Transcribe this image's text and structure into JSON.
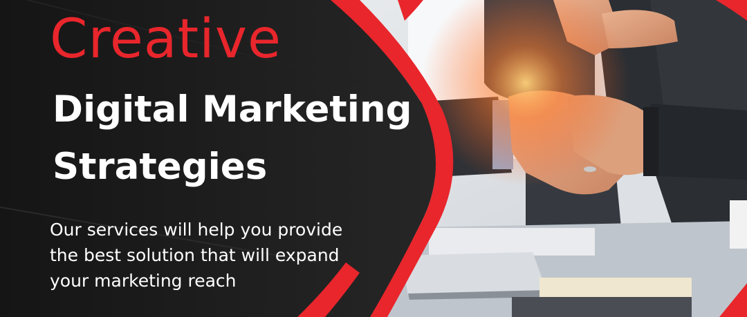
{
  "banner": {
    "headline_accent": "Creative",
    "headline_line1": "Digital Marketing",
    "headline_line2": "Strategies",
    "tagline": [
      "Our services will help you provide",
      "the best solution that will expand",
      "your marketing reach"
    ]
  },
  "colors": {
    "accent_red": "#e8262c",
    "dark_panel": "#1c1c1c",
    "text_white": "#ffffff"
  },
  "photo": {
    "subject": "handshake-photo"
  }
}
